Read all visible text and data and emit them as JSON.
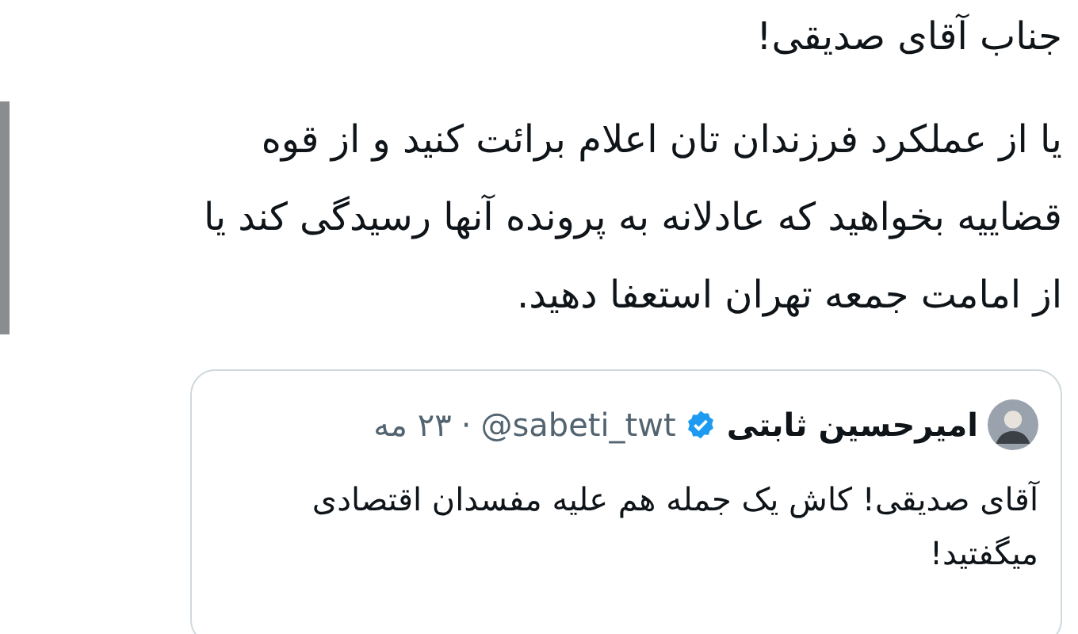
{
  "tweet": {
    "greeting": "جناب آقای صدیقی!",
    "body_lines": [
      "یا از عملکرد فرزندان تان اعلام برائت کنید و از قوه",
      "قضاییه بخواهید که عادلانه به پرونده آنها رسیدگی کند یا",
      "از امامت جمعه تهران استعفا دهید."
    ]
  },
  "quoted_tweet": {
    "name": "امیرحسین ثابتی",
    "verified": true,
    "handle": "@sabeti_twt",
    "separator": "·",
    "date": "۲۳ مه",
    "body_lines": [
      "آقای صدیقی! کاش یک جمله هم علیه مفسدان اقتصادی",
      "میگفتید!"
    ]
  }
}
